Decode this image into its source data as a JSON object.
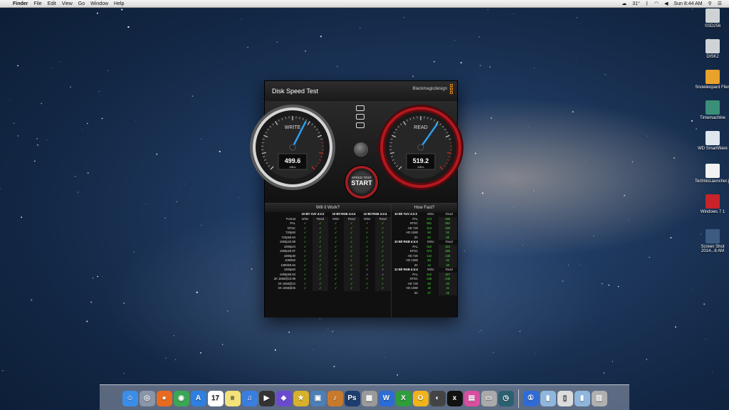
{
  "menubar": {
    "app_name": "Finder",
    "menus": [
      "File",
      "Edit",
      "View",
      "Go",
      "Window",
      "Help"
    ],
    "status": {
      "temperature": "31°",
      "clock": "Sun 8:44 AM"
    }
  },
  "desktop_icons": [
    {
      "label": "SSD256",
      "icon": "drive-icon",
      "color": "#cfd3d6"
    },
    {
      "label": "DISK2",
      "icon": "drive-icon",
      "color": "#cfd3d6"
    },
    {
      "label": "Snowleopard Files",
      "icon": "folder-icon",
      "color": "#e9a22a"
    },
    {
      "label": "Timemachine",
      "icon": "timemachine-icon",
      "color": "#3a8f78"
    },
    {
      "label": "WD SmartWare",
      "icon": "disc-icon",
      "color": "#dfe6ee"
    },
    {
      "label": "TechnicLauncher.jar",
      "icon": "java-icon",
      "color": "#f2f2f2"
    },
    {
      "label": "Windows 7 1",
      "icon": "parallels-icon",
      "color": "#c8232a"
    },
    {
      "label": "Screen Shot 2014...8 AM",
      "icon": "screenshot-icon",
      "color": "#3d5a80"
    }
  ],
  "window": {
    "title": "Disk Speed Test",
    "brand": "Blackmagicdesign",
    "gauges": {
      "write": {
        "label": "WRITE",
        "value": "499.6",
        "unit": "MB/s",
        "level": 0.6
      },
      "read": {
        "label": "READ",
        "value": "519.2",
        "unit": "MB/s",
        "level": 0.63
      }
    },
    "start_button": {
      "small": "SPEED TEST",
      "big": "START"
    },
    "will_it_work": {
      "title": "Will it Work?",
      "groups": [
        "10 Bit YUV 4:2:2",
        "10 Bit RGB 4:4:4",
        "12 Bit RGB 4:4:4"
      ],
      "format_label": "Format",
      "write_label": "Write",
      "read_label": "Read",
      "rows": [
        {
          "format": "PAL",
          "marks": [
            "y",
            "y",
            "y",
            "y",
            "y",
            "y"
          ]
        },
        {
          "format": "NTSC",
          "marks": [
            "y",
            "y",
            "y",
            "y",
            "y",
            "y"
          ]
        },
        {
          "format": "720p50",
          "marks": [
            "y",
            "y",
            "y",
            "y",
            "y",
            "y"
          ]
        },
        {
          "format": "720p59.94",
          "marks": [
            "y",
            "y",
            "y",
            "y",
            "y",
            "y"
          ]
        },
        {
          "format": "1080p23.98",
          "marks": [
            "y",
            "y",
            "y",
            "y",
            "y",
            "y"
          ]
        },
        {
          "format": "1080p24",
          "marks": [
            "y",
            "y",
            "y",
            "y",
            "y",
            "y"
          ]
        },
        {
          "format": "1080p29.97",
          "marks": [
            "y",
            "y",
            "y",
            "y",
            "y",
            "y"
          ]
        },
        {
          "format": "1080p30",
          "marks": [
            "y",
            "y",
            "y",
            "y",
            "y",
            "y"
          ]
        },
        {
          "format": "1080i50",
          "marks": [
            "y",
            "y",
            "y",
            "y",
            "y",
            "y"
          ]
        },
        {
          "format": "1080i59.94",
          "marks": [
            "y",
            "y",
            "y",
            "y",
            "y",
            "y"
          ]
        },
        {
          "format": "1080p50",
          "marks": [
            "y",
            "y",
            "y",
            "y",
            "n",
            "n"
          ]
        },
        {
          "format": "1080p59.94",
          "marks": [
            "y",
            "y",
            "y",
            "y",
            "n",
            "n"
          ]
        },
        {
          "format": "2K 1556@23.98",
          "marks": [
            "y",
            "y",
            "y",
            "y",
            "y",
            "y"
          ]
        },
        {
          "format": "2K 1556@24",
          "marks": [
            "y",
            "y",
            "y",
            "y",
            "y",
            "y"
          ]
        },
        {
          "format": "2K 1556@25",
          "marks": [
            "y",
            "y",
            "y",
            "y",
            "y",
            "y"
          ]
        }
      ]
    },
    "how_fast": {
      "title": "How Fast?",
      "groups": [
        {
          "name": "10 Bit YUV 4:2:2",
          "rows": [
            {
              "format": "PAL",
              "write": "473",
              "read": "488"
            },
            {
              "format": "NTSC",
              "write": "561",
              "read": "552"
            },
            {
              "format": "HD 720",
              "write": "213",
              "read": "209"
            },
            {
              "format": "HD 1080",
              "write": "94",
              "read": "93"
            },
            {
              "format": "2K",
              "write": "61",
              "read": "60"
            }
          ]
        },
        {
          "name": "10 Bit RGB 4:4:4",
          "rows": [
            {
              "format": "PAL",
              "write": "315",
              "read": "310"
            },
            {
              "format": "NTSC",
              "write": "374",
              "read": "368"
            },
            {
              "format": "HD 720",
              "write": "142",
              "read": "139"
            },
            {
              "format": "HD 1080",
              "write": "63",
              "read": "62"
            },
            {
              "format": "2K",
              "write": "41",
              "read": "40"
            }
          ]
        },
        {
          "name": "12 Bit RGB 4:4:4",
          "rows": [
            {
              "format": "PAL",
              "write": "210",
              "read": "207"
            },
            {
              "format": "NTSC",
              "write": "249",
              "read": "245"
            },
            {
              "format": "HD 720",
              "write": "94",
              "read": "93"
            },
            {
              "format": "HD 1080",
              "write": "42",
              "read": "41"
            },
            {
              "format": "2K",
              "write": "27",
              "read": "26"
            }
          ]
        }
      ]
    }
  },
  "dock": [
    {
      "name": "finder",
      "color": "#3b8ee8",
      "glyph": "☺"
    },
    {
      "name": "launchpad",
      "color": "#8a96a8",
      "glyph": "◎"
    },
    {
      "name": "firefox",
      "color": "#e66a1f",
      "glyph": "●"
    },
    {
      "name": "chrome",
      "color": "#3aa757",
      "glyph": "◉"
    },
    {
      "name": "app-store",
      "color": "#2d7fe0",
      "glyph": "A"
    },
    {
      "name": "calendar",
      "color": "#ffffff",
      "glyph": "17"
    },
    {
      "name": "stickies",
      "color": "#f3e27a",
      "glyph": "≡"
    },
    {
      "name": "itunes",
      "color": "#3a7ee0",
      "glyph": "♫"
    },
    {
      "name": "final-cut",
      "color": "#333333",
      "glyph": "▶"
    },
    {
      "name": "motion",
      "color": "#6a4bd0",
      "glyph": "◈"
    },
    {
      "name": "imovie",
      "color": "#d8b12a",
      "glyph": "★"
    },
    {
      "name": "iphoto",
      "color": "#4b7fb8",
      "glyph": "▣"
    },
    {
      "name": "garageband",
      "color": "#c87a2c",
      "glyph": "♪"
    },
    {
      "name": "photoshop",
      "color": "#1c3d6e",
      "glyph": "Ps"
    },
    {
      "name": "photo-booth",
      "color": "#9a9a9a",
      "glyph": "▩"
    },
    {
      "name": "word",
      "color": "#2b6cd6",
      "glyph": "W"
    },
    {
      "name": "excel",
      "color": "#2e9d3b",
      "glyph": "X"
    },
    {
      "name": "outlook",
      "color": "#f0b41a",
      "glyph": "O"
    },
    {
      "name": "dvd-player",
      "color": "#444444",
      "glyph": "◐"
    },
    {
      "name": "xbmc",
      "color": "#111111",
      "glyph": "x"
    },
    {
      "name": "iphoto-library",
      "color": "#d94ea0",
      "glyph": "▤"
    },
    {
      "name": "macbook",
      "color": "#aaaaaa",
      "glyph": "▭"
    },
    {
      "name": "time-machine",
      "color": "#2a6070",
      "glyph": "◷"
    },
    {
      "name": "1password",
      "color": "#2f6bd6",
      "glyph": "①"
    },
    {
      "name": "applications-folder",
      "color": "#8fb6dd",
      "glyph": "▮"
    },
    {
      "name": "documents-folder",
      "color": "#dcdcdc",
      "glyph": "▯"
    },
    {
      "name": "downloads-folder",
      "color": "#8fb6dd",
      "glyph": "▮"
    },
    {
      "name": "trash",
      "color": "#b0b0b0",
      "glyph": "▥"
    }
  ]
}
